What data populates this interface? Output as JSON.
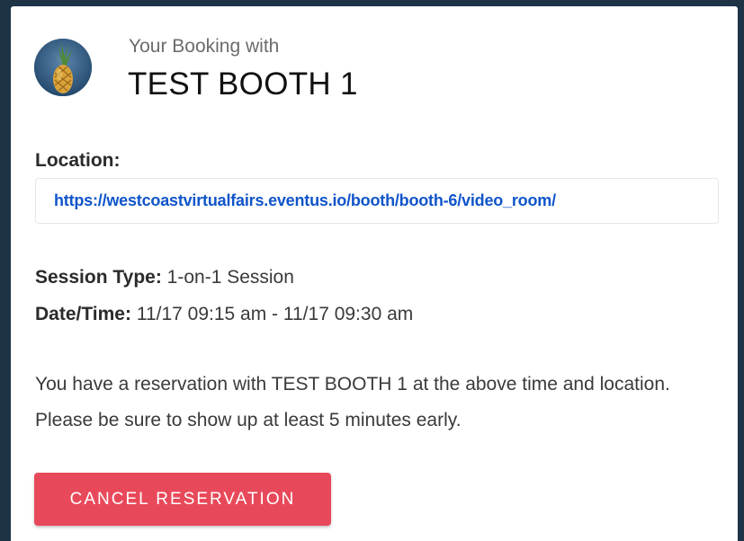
{
  "booking": {
    "subtitle": "Your Booking with",
    "booth_name": "TEST BOOTH 1",
    "avatar_icon": "pineapple-icon"
  },
  "location": {
    "label": "Location:",
    "url": "https://westcoastvirtualfairs.eventus.io/booth/booth-6/video_room/"
  },
  "details": {
    "session_type_label": "Session Type:",
    "session_type_value": "1-on-1 Session",
    "datetime_label": "Date/Time:",
    "datetime_value": "11/17 09:15 am - 11/17 09:30 am"
  },
  "message": "You have a reservation with TEST BOOTH 1 at the above time and location. Please be sure to show up at least 5 minutes early.",
  "actions": {
    "cancel_label": "CANCEL RESERVATION"
  },
  "colors": {
    "background": "#1d3447",
    "card": "#ffffff",
    "link": "#1055c9",
    "cancel_button": "#e8495a"
  }
}
